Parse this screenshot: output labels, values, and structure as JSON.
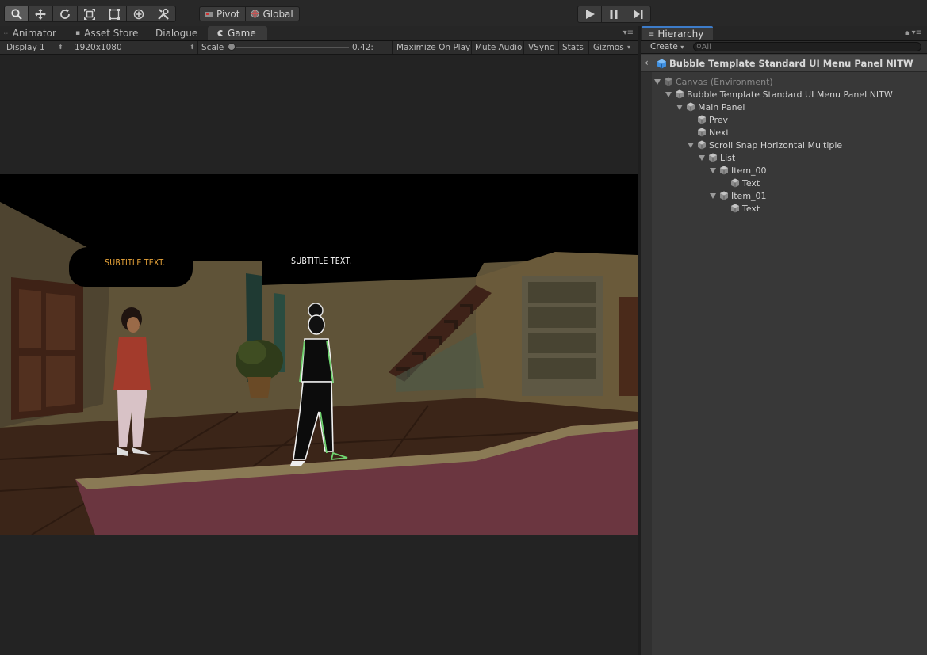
{
  "toolbar": {
    "tools": [
      "hand-tool-icon",
      "move-tool-icon",
      "rotate-tool-icon",
      "scale-tool-icon",
      "rect-tool-icon",
      "transform-tool-icon",
      "custom-tool-icon"
    ],
    "pivot_label": "Pivot",
    "global_label": "Global"
  },
  "tabs": {
    "animator": "Animator",
    "asset_store": "Asset Store",
    "dialogue": "Dialogue",
    "game": "Game"
  },
  "game_toolbar": {
    "display": "Display 1",
    "resolution": "1920x1080",
    "scale_label": "Scale",
    "scale_value": "0.42:",
    "scale_fraction": 0.0,
    "maximize_on_play": "Maximize On Play",
    "mute_audio": "Mute Audio",
    "vsync": "VSync",
    "stats": "Stats",
    "gizmos": "Gizmos"
  },
  "game_view": {
    "subtitle_left": "SUBTITLE TEXT.",
    "subtitle_right": "SUBTITLE TEXT.",
    "subtitle_left_color": "#e8a43a",
    "subtitle_right_color": "#ffffff"
  },
  "hierarchy": {
    "tab_label": "Hierarchy",
    "create_label": "Create",
    "search_placeholder": "All",
    "scene_title": "Bubble Template Standard UI Menu Panel NITW",
    "items": [
      {
        "label": "Canvas (Environment)",
        "depth": 0,
        "expanded": true,
        "dim": true
      },
      {
        "label": "Bubble Template Standard UI Menu Panel NITW",
        "depth": 1,
        "expanded": true
      },
      {
        "label": "Main Panel",
        "depth": 2,
        "expanded": true
      },
      {
        "label": "Prev",
        "depth": 3,
        "expanded": null
      },
      {
        "label": "Next",
        "depth": 3,
        "expanded": null
      },
      {
        "label": "Scroll Snap Horizontal Multiple",
        "depth": 3,
        "expanded": true
      },
      {
        "label": "List",
        "depth": 4,
        "expanded": true
      },
      {
        "label": "Item_00",
        "depth": 5,
        "expanded": true
      },
      {
        "label": "Text",
        "depth": 6,
        "expanded": null
      },
      {
        "label": "Item_01",
        "depth": 5,
        "expanded": true
      },
      {
        "label": "Text",
        "depth": 6,
        "expanded": null
      }
    ]
  },
  "colors": {
    "accent": "#3d7cc9",
    "panel_bg": "#383838"
  }
}
